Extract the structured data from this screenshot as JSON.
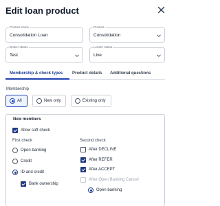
{
  "modal": {
    "title": "Edit loan product"
  },
  "fields": {
    "product_name": {
      "label": "Product name",
      "value": "Consolidation Loan"
    },
    "product_type": {
      "label": "Product",
      "value": "Consolidation"
    },
    "broker_status": {
      "label": "Broker status",
      "value": "Test"
    },
    "lender_status": {
      "label": "Lender status",
      "value": "Live"
    }
  },
  "tabs": [
    {
      "label": "Membership & check types",
      "active": true
    },
    {
      "label": "Product details",
      "active": false
    },
    {
      "label": "Additional questions",
      "active": false
    }
  ],
  "membership": {
    "label": "Membership",
    "options": [
      {
        "label": "All",
        "selected": true
      },
      {
        "label": "New only",
        "selected": false
      },
      {
        "label": "Existing only",
        "selected": false
      }
    ]
  },
  "new_members": {
    "title": "New members",
    "allow_soft_check": {
      "label": "Allow soft check",
      "checked": true
    },
    "first_check": {
      "heading": "First check",
      "options": [
        {
          "label": "Open banking",
          "selected": false
        },
        {
          "label": "Credit",
          "selected": false
        },
        {
          "label": "ID and credit",
          "selected": true
        }
      ],
      "bank_ownership": {
        "label": "Bank ownership",
        "checked": true
      }
    },
    "second_check": {
      "heading": "Second check",
      "options": [
        {
          "label": "After DECLINE",
          "checked": false,
          "disabled": false
        },
        {
          "label": "After REFER",
          "checked": true,
          "disabled": false
        },
        {
          "label": "After ACCEPT",
          "checked": true,
          "disabled": false
        },
        {
          "label": "After Open Banking Cancel",
          "checked": false,
          "disabled": true
        }
      ],
      "sub_option": {
        "label": "Open banking",
        "selected": true
      }
    }
  },
  "colors": {
    "accent": "#1e3a8a",
    "border": "#c9ced6",
    "selected_bg": "#eef4ff"
  }
}
